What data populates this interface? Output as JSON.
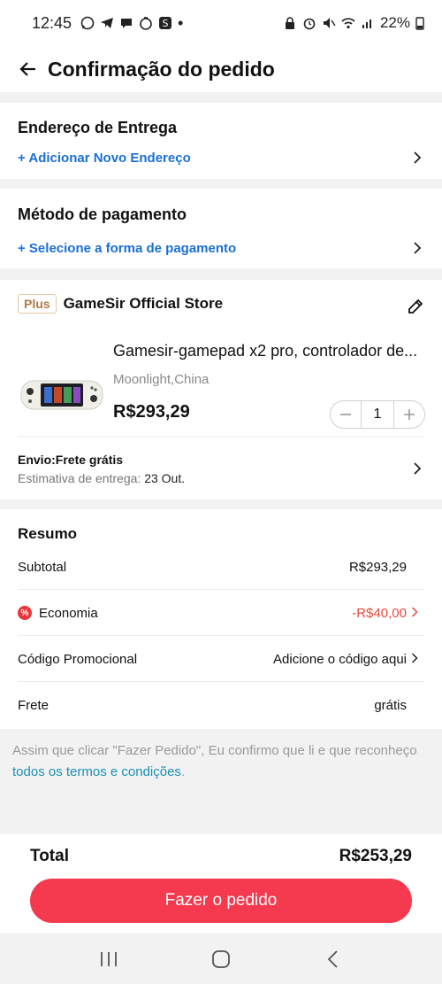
{
  "status": {
    "time": "12:45",
    "battery": "22%",
    "dot": "•"
  },
  "header": {
    "title": "Confirmação do pedido"
  },
  "address": {
    "title": "Endereço de Entrega",
    "link": "+ Adicionar Novo Endereço"
  },
  "payment": {
    "title": "Método de pagamento",
    "link": "+ Selecione a forma de pagamento"
  },
  "store": {
    "badge": "Plus",
    "name": "GameSir Official Store"
  },
  "product": {
    "title": "Gamesir-gamepad x2 pro, controlador de...",
    "variant": "Moonlight,China",
    "price": "R$293,29",
    "quantity": "1"
  },
  "shipping": {
    "title": "Envio:Frete grátis",
    "estimate_label": "Estimativa de entrega:",
    "estimate_date": "23 Out."
  },
  "summary": {
    "title": "Resumo",
    "subtotal_label": "Subtotal",
    "subtotal_value": "R$293,29",
    "savings_label": "Economia",
    "savings_value": "-R$40,00",
    "promo_label": "Código Promocional",
    "promo_value": "Adicione o código aqui",
    "shipping_label": "Frete",
    "shipping_value": "grátis"
  },
  "terms": {
    "text": "Assim que clicar \"Fazer Pedido\", Eu confirmo que li e que reconheço",
    "link": "todos os termos e condições",
    "end": "."
  },
  "footer": {
    "total_label": "Total",
    "total_value": "R$253,29",
    "order_button": "Fazer o pedido"
  },
  "colors": {
    "accent": "#f53a4f",
    "link": "#1a6fd6",
    "discount": "#e94a3b"
  }
}
